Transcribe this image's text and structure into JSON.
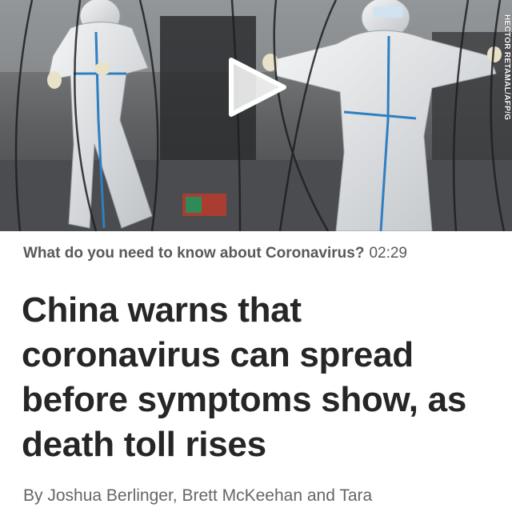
{
  "video": {
    "photo_credit": "HECTOR RETAMAL/AFP/G",
    "play_icon": "play-icon",
    "caption": "What do you need to know about Coronavirus?",
    "duration": "02:29"
  },
  "article": {
    "headline": "China warns that coronavirus can spread before symptoms show, as death toll rises",
    "byline": "By Joshua Berlinger, Brett McKeehan and Tara"
  },
  "colors": {
    "headline": "#262626",
    "caption": "#595959",
    "byline": "#666666",
    "protective_tape": "#2f7fc0"
  }
}
